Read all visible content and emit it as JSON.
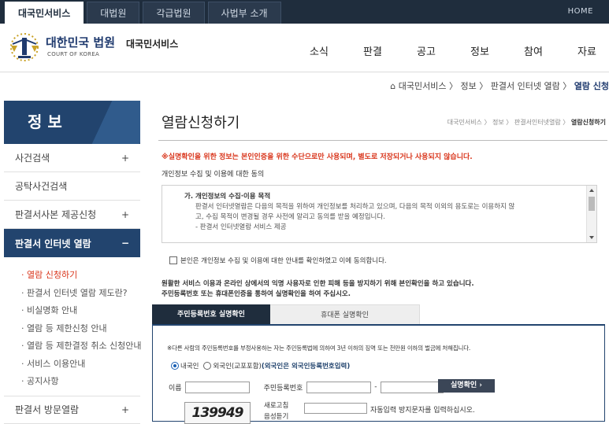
{
  "topbar": {
    "tabs": [
      "대국민서비스",
      "대법원",
      "각급법원",
      "사법부 소개"
    ],
    "home": "HOME"
  },
  "header": {
    "logo_kr": "대한민국 법원",
    "logo_en": "COURT OF KOREA",
    "service": "대국민서비스",
    "gnb": [
      "소식",
      "판결",
      "공고",
      "정보",
      "참여",
      "자료"
    ]
  },
  "breadcrumb": {
    "home": "대국민서비스",
    "items": [
      "정보",
      "판결서 인터넷 열람"
    ],
    "current": "열람 신청"
  },
  "lnb": {
    "title": "정 보",
    "items": [
      {
        "label": "사건검색",
        "plus": "+"
      },
      {
        "label": "공탁사건검색",
        "plus": ""
      },
      {
        "label": "판결서사본 제공신청",
        "plus": "+"
      }
    ],
    "active": {
      "label": "판결서 인터넷 열람",
      "minus": "−"
    },
    "sub": [
      "· 열람 신청하기",
      "· 판결서 인터넷 열람 제도란?",
      "· 비실명화 안내",
      "· 열람 등 제한신청 안내",
      "· 열람 등 제한결정 취소 신청안내",
      "· 서비스 이용안내",
      "· 공지사항"
    ],
    "bottom": {
      "label": "판결서 방문열람",
      "plus": "+"
    }
  },
  "main": {
    "title": "열람신청하기",
    "sub_breadcrumb": [
      "대국민서비스",
      "정보",
      "판결서인터넷열람"
    ],
    "sub_breadcrumb_current": "열람신청하기",
    "notice": "※실명확인을 위한 정보는 본인인증을 위한 수단으로만 사용되며, 별도로 저장되거나 사용되지 않습니다.",
    "consent_heading": "개인정보 수집 및 이용에 대한 동의",
    "consent_box": {
      "heading": "가. 개인정보의 수집·이용 목적",
      "lines": [
        "판결서 인터넷열람은 다음의 목적을 위하여 개인정보를 처리하고 있으며, 다음의 목적 이외의 용도로는 이용하지 않",
        "고, 수집 목적이 변경될 경우 사전에 알리고 동의를 받을 예정입니다.",
        "- 판결서 인터넷열람 서비스 제공"
      ]
    },
    "agree_label": "본인은 개인정보 수집 및 이용에 대한 안내를 확인하였고 이에 동의합니다.",
    "guide_lines": [
      "원활한 서비스 이용과 온라인 상에서의 익명 사용자로 인한 피해 등을 방지하기 위해 본인확인을 하고 있습니다.",
      "주민등록번호 또는 휴대폰인증을 통하여 실명확인을 하여 주십시오."
    ],
    "tabs": [
      "주민등록번호 실명확인",
      "휴대폰 실명확인"
    ],
    "warning": "※다른 사람의 주민등록번호를 부정사용하는 자는 주민등록법에 의하여 3년 이하의 징역 또는 천만원 이하의 벌금에 처해집니다.",
    "radio_domestic": "내국인",
    "radio_foreign": "외국인(교포포함)",
    "radio_foreign_link": "(외국인은 외국인등록번호입력)",
    "name_label": "이름",
    "rrn_label": "주민등록번호",
    "rrn_dash": "-",
    "confirm_button": "실명확인 ›",
    "captcha_text": "139949",
    "captcha_refresh": "새로고침",
    "captcha_audio": "음성듣기",
    "captcha_hint": "자동입력 방지문자를 입력하십시오."
  }
}
